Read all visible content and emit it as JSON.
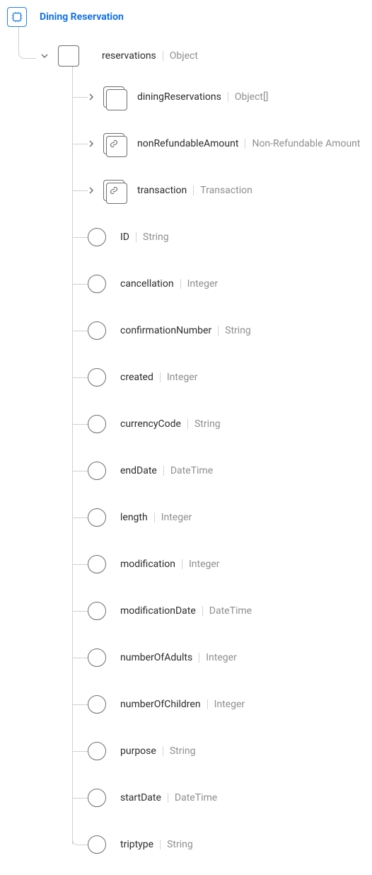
{
  "header": {
    "title": "Dining Reservation"
  },
  "root": {
    "name": "reservations",
    "type": "Object"
  },
  "children": [
    {
      "kind": "arrayObject",
      "name": "diningReservations",
      "type": "Object[]"
    },
    {
      "kind": "link",
      "name": "nonRefundableAmount",
      "type": "Non-Refundable Amount"
    },
    {
      "kind": "link",
      "name": "transaction",
      "type": "Transaction"
    },
    {
      "kind": "leaf",
      "name": "ID",
      "type": "String"
    },
    {
      "kind": "leaf",
      "name": "cancellation",
      "type": "Integer"
    },
    {
      "kind": "leaf",
      "name": "confirmationNumber",
      "type": "String"
    },
    {
      "kind": "leaf",
      "name": "created",
      "type": "Integer"
    },
    {
      "kind": "leaf",
      "name": "currencyCode",
      "type": "String"
    },
    {
      "kind": "leaf",
      "name": "endDate",
      "type": "DateTime"
    },
    {
      "kind": "leaf",
      "name": "length",
      "type": "Integer"
    },
    {
      "kind": "leaf",
      "name": "modification",
      "type": "Integer"
    },
    {
      "kind": "leaf",
      "name": "modificationDate",
      "type": "DateTime"
    },
    {
      "kind": "leaf",
      "name": "numberOfAdults",
      "type": "Integer"
    },
    {
      "kind": "leaf",
      "name": "numberOfChildren",
      "type": "Integer"
    },
    {
      "kind": "leaf",
      "name": "purpose",
      "type": "String"
    },
    {
      "kind": "leaf",
      "name": "startDate",
      "type": "DateTime"
    },
    {
      "kind": "leaf",
      "name": "triptype",
      "type": "String"
    }
  ]
}
